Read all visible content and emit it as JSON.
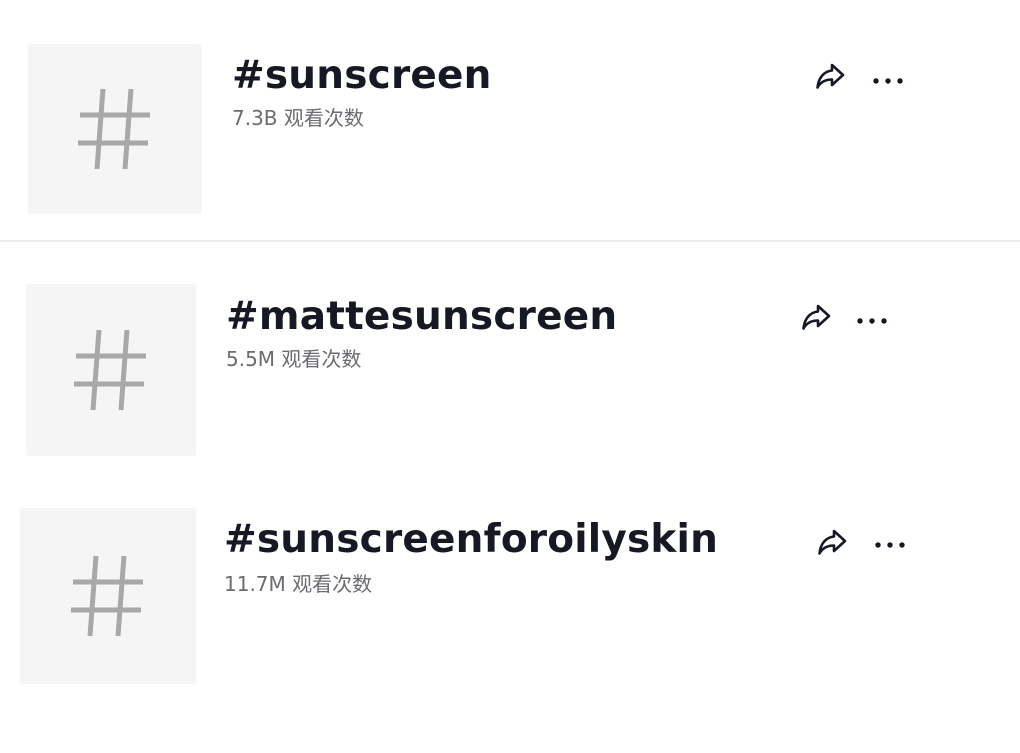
{
  "hashtags": [
    {
      "title": "#sunscreen",
      "views": "7.3B 观看次数"
    },
    {
      "title": "#mattesunscreen",
      "views": "5.5M 观看次数"
    },
    {
      "title": "#sunscreenforoilyskin",
      "views": "11.7M 观看次数"
    }
  ],
  "icons": {
    "thumbnail": "hashtag-icon",
    "share": "share-icon",
    "more": "more-icon"
  },
  "colors": {
    "title": "#161823",
    "views": "#6b6b70",
    "thumbnail_bg": "#f5f5f5",
    "hash_symbol": "#a8a8a8"
  }
}
